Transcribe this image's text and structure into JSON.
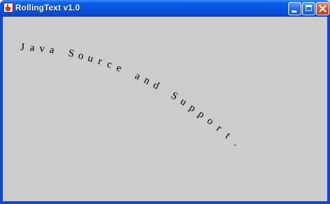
{
  "window": {
    "title": "RollingText v1.0",
    "app_icon": "java-cup-icon",
    "controls": {
      "minimize_icon": "minimize-icon",
      "maximize_icon": "maximize-icon",
      "close_icon": "close-icon"
    }
  },
  "content": {
    "background_color": "#cccccc",
    "rolling_text": "Java Source and Support."
  }
}
